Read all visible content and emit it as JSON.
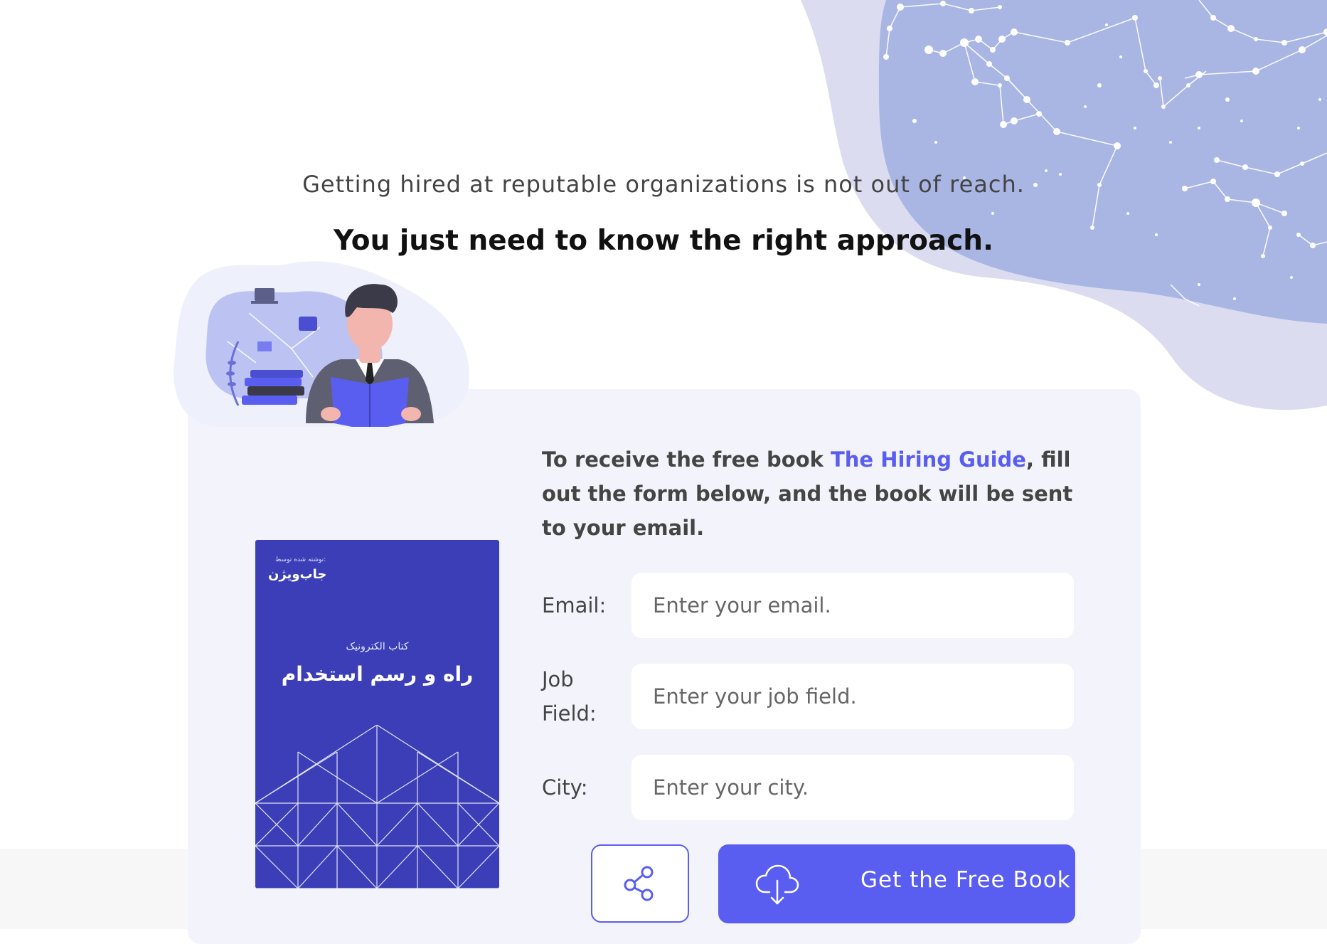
{
  "intro": {
    "line1": "Getting hired at reputable organizations is not out of reach.",
    "line2": "You just need to know the right approach."
  },
  "book": {
    "brand_small": "نوشته شده توسط:",
    "brand": "جاب‌ویژن",
    "subtitle": "کتاب الکترونیک",
    "title": "راه و رسم استخدام"
  },
  "info": {
    "before": "To receive the free book ",
    "highlight": "The Hiring Guide",
    "after": ", fill out the form below, and the book will be sent to your email."
  },
  "form": {
    "email_label": "Email:",
    "email_placeholder": "Enter your email.",
    "email_value": "",
    "job_label_line1": "Job",
    "job_label_line2": "Field:",
    "job_placeholder": "Enter your job field.",
    "job_value": "",
    "city_label": "City:",
    "city_placeholder": "Enter your city.",
    "city_value": ""
  },
  "buttons": {
    "share_icon": "share-icon",
    "get_label": "Get the Free Book",
    "get_icon": "cloud-download-icon"
  },
  "colors": {
    "accent": "#5a5ef0",
    "book_cover": "#3b3eb6",
    "card_bg": "#f3f4fb",
    "blob_light": "#dcdcf0",
    "blob_dark": "#a9b6e4"
  }
}
